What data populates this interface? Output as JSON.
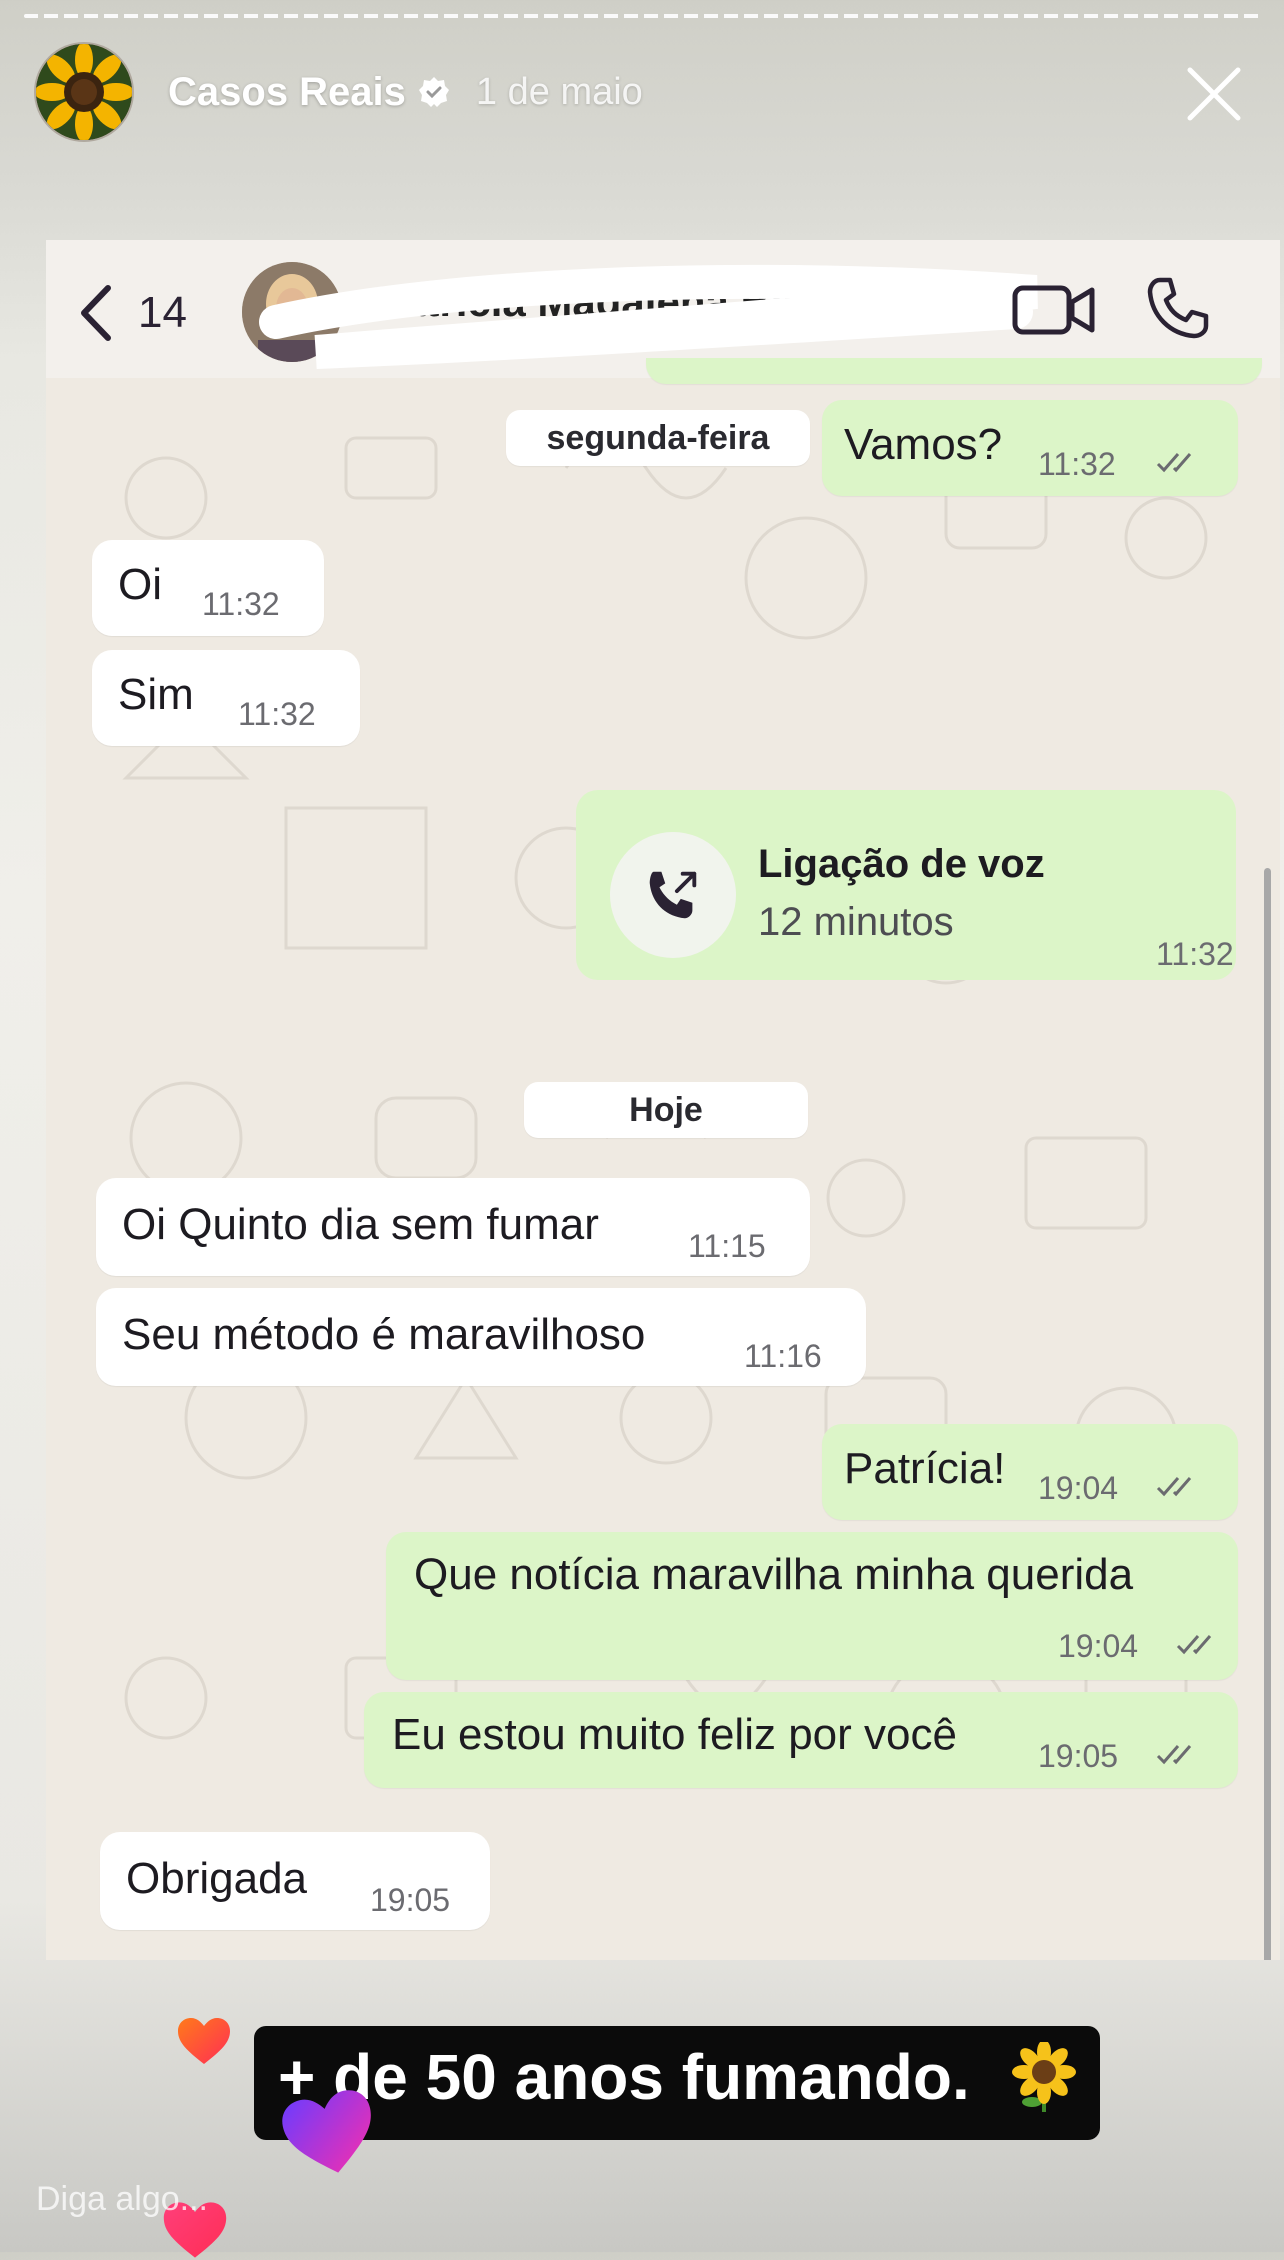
{
  "story": {
    "account_name": "Casos Reais",
    "date": "1 de maio",
    "reply_placeholder": "Diga algo..."
  },
  "chat_header": {
    "back_count": "14",
    "contact_name": "Patrícia Madalena Barros..."
  },
  "messages": [
    {
      "dir": "out",
      "text": "Vamos?",
      "time": "11:32",
      "read": true
    },
    {
      "dir": "in",
      "text": "Oi",
      "time": "11:32"
    },
    {
      "dir": "in",
      "text": "Sim",
      "time": "11:32"
    },
    {
      "dir": "in",
      "text": "Oi Quinto dia sem fumar",
      "time": "11:15"
    },
    {
      "dir": "in",
      "text": "Seu método é maravilhoso",
      "time": "11:16"
    },
    {
      "dir": "out",
      "text": "Patrícia!",
      "time": "19:04",
      "read": true
    },
    {
      "dir": "out",
      "text": "Que notícia maravilha minha querida",
      "time": "19:04",
      "read": true
    },
    {
      "dir": "out",
      "text": "Eu estou muito feliz por você",
      "time": "19:05",
      "read": true
    },
    {
      "dir": "in",
      "text": "Obrigada",
      "time": "19:05"
    }
  ],
  "date_separators": [
    "segunda-feira",
    "Hoje"
  ],
  "call": {
    "title": "Ligação de voz",
    "duration": "12 minutos",
    "time": "11:32"
  },
  "caption": {
    "text": "+ de 50 anos fumando."
  },
  "icons": {
    "verified": "verified-badge-icon",
    "close": "close-icon",
    "back": "chevron-left-icon",
    "video": "video-call-icon",
    "phone": "phone-icon",
    "call": "outgoing-call-icon",
    "read_receipt": "double-check-icon",
    "caption_emoji": "sunflower-icon",
    "reactions": "heart-icon"
  },
  "colors": {
    "outgoing_bubble": "#dcf5c8",
    "incoming_bubble": "#ffffff",
    "chat_background": "#efeae2",
    "caption_background": "#0b0b0b"
  }
}
